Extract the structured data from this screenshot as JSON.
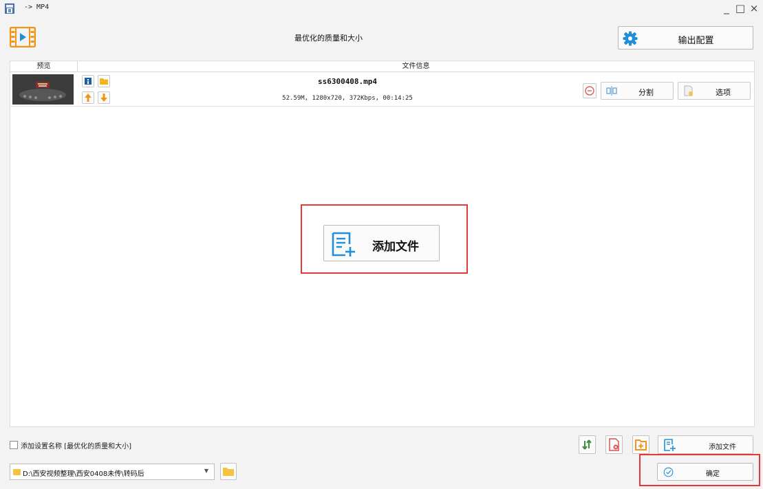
{
  "window": {
    "title": "-> MP4",
    "minimize_glyph": "_",
    "maximize_glyph": "□",
    "close_glyph": "×"
  },
  "header": {
    "profile_name": "最优化的质量和大小",
    "output_config_label": "输出配置"
  },
  "table": {
    "columns": [
      "预览",
      "文件信息"
    ],
    "rows": [
      {
        "filename": "ss6300408.mp4",
        "meta": "52.59M, 1280x720, 372Kbps, 00:14:25",
        "split_label": "分割",
        "options_label": "选项"
      }
    ]
  },
  "center": {
    "add_file_label": "添加文件"
  },
  "bottom": {
    "checkbox_label": "添加设置名称 [最优化的质量和大小]",
    "checkbox_checked": false,
    "add_file_label": "添加文件",
    "output_path": "D:\\西安视频整理\\西安0408未传\\转码后",
    "ok_label": "确定"
  },
  "colors": {
    "accent_orange": "#f29418",
    "accent_blue": "#1e8fd8",
    "accent_green": "#3a8f3a",
    "accent_red": "#d9534f",
    "highlight_red": "#e53935"
  }
}
